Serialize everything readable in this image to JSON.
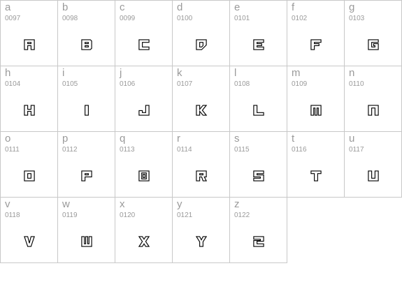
{
  "glyphs": [
    {
      "char": "a",
      "code": "0097"
    },
    {
      "char": "b",
      "code": "0098"
    },
    {
      "char": "c",
      "code": "0099"
    },
    {
      "char": "d",
      "code": "0100"
    },
    {
      "char": "e",
      "code": "0101"
    },
    {
      "char": "f",
      "code": "0102"
    },
    {
      "char": "g",
      "code": "0103"
    },
    {
      "char": "h",
      "code": "0104"
    },
    {
      "char": "i",
      "code": "0105"
    },
    {
      "char": "j",
      "code": "0106"
    },
    {
      "char": "k",
      "code": "0107"
    },
    {
      "char": "l",
      "code": "0108"
    },
    {
      "char": "m",
      "code": "0109"
    },
    {
      "char": "n",
      "code": "0110"
    },
    {
      "char": "o",
      "code": "0111"
    },
    {
      "char": "p",
      "code": "0112"
    },
    {
      "char": "q",
      "code": "0113"
    },
    {
      "char": "r",
      "code": "0114"
    },
    {
      "char": "s",
      "code": "0115"
    },
    {
      "char": "t",
      "code": "0116"
    },
    {
      "char": "u",
      "code": "0117"
    },
    {
      "char": "v",
      "code": "0118"
    },
    {
      "char": "w",
      "code": "0119"
    },
    {
      "char": "x",
      "code": "0120"
    },
    {
      "char": "y",
      "code": "0121"
    },
    {
      "char": "z",
      "code": "0122"
    }
  ]
}
